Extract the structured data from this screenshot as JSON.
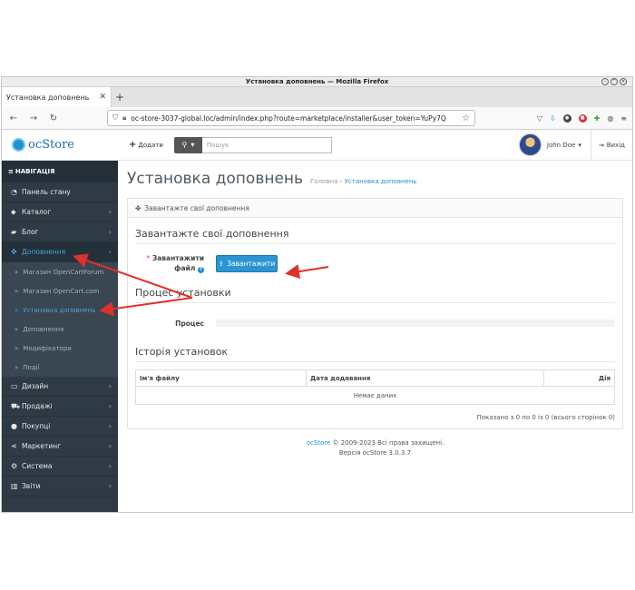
{
  "window": {
    "title": "Установка доповнень — Mozilla Firefox"
  },
  "browser": {
    "tab_title": "Установка доповнень",
    "url": "oc-store-3037-global.loc/admin/index.php?route=marketplace/installer&user_token=YuPy7Q"
  },
  "header": {
    "logo_text": "ocStore",
    "add_label": "Додати",
    "search_placeholder": "Пошук",
    "user_name": "John Doe",
    "logout_label": "Вихід"
  },
  "sidebar": {
    "nav_title": "НАВІГАЦІЯ",
    "items": [
      {
        "label": "Панель стану",
        "icon": "dashboard-icon"
      },
      {
        "label": "Каталог",
        "icon": "tag-icon"
      },
      {
        "label": "Блог",
        "icon": "book-icon"
      },
      {
        "label": "Доповнення",
        "icon": "puzzle-icon"
      },
      {
        "label": "Дизайн",
        "icon": "monitor-icon"
      },
      {
        "label": "Продажі",
        "icon": "cart-icon"
      },
      {
        "label": "Покупці",
        "icon": "user-icon"
      },
      {
        "label": "Маркетинг",
        "icon": "share-icon"
      },
      {
        "label": "Система",
        "icon": "gear-icon"
      },
      {
        "label": "Звіти",
        "icon": "bar-chart-icon"
      }
    ],
    "sub_items": [
      "Магазин OpenCartForum",
      "Магазин OpenCart.com",
      "Установка доповнень",
      "Доповнення",
      "Модифікатори",
      "Події"
    ]
  },
  "page": {
    "title": "Установка доповнень",
    "breadcrumb_home": "Головна",
    "breadcrumb_current": "Установка доповнень",
    "panel_heading": "Завантажте свої доповнення",
    "section_upload": "Завантажте свої доповнення",
    "upload_label_line1": "Завантажити",
    "upload_label_line2": "файл",
    "upload_button": "Завантажити",
    "section_progress": "Процес установки",
    "progress_label": "Процес",
    "progress_value": 0,
    "section_history": "Історія установок",
    "table_headers": [
      "Ім'я файлу",
      "Дата додавання",
      "Дія"
    ],
    "empty_text": "Немає даних",
    "pager_text": "Показано з 0 по 0 із 0 (всього сторінок 0)"
  },
  "footer": {
    "brand": "ocStore",
    "copyright": "© 2009-2023 Всі права захищені.",
    "version": "Версія ocStore 3.0.3.7"
  },
  "colors": {
    "sidebar": "#2e3a45",
    "accent": "#1e91cf",
    "arrow": "#e0302b",
    "button": "#2b95d1"
  }
}
